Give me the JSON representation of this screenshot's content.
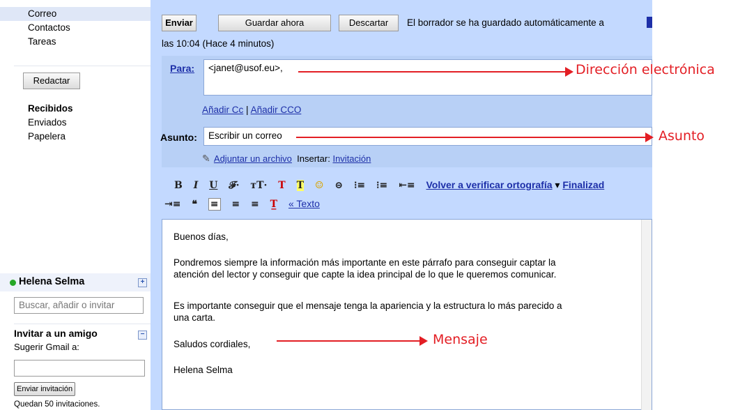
{
  "sidebar": {
    "nav": [
      "Correo",
      "Contactos",
      "Tareas"
    ],
    "compose_label": "Redactar",
    "folders": [
      "Recibidos",
      "Enviados",
      "Papelera"
    ],
    "chat": {
      "user_name": "Helena Selma",
      "expand_label": "+",
      "search_placeholder": "Buscar, añadir o invitar"
    },
    "invite": {
      "title": "Invitar a un amigo",
      "collapse_label": "−",
      "subtitle": "Sugerir Gmail a:",
      "send_label": "Enviar invitación",
      "remaining": "Quedan 50 invitaciones."
    }
  },
  "compose": {
    "send_label": "Enviar",
    "save_label": "Guardar ahora",
    "discard_label": "Descartar",
    "autosave_text": "El borrador se ha guardado automáticamente a",
    "autosave_time": "las 10:04 (Hace 4 minutos)",
    "to_label": "Para:",
    "to_value": "<janet@usof.eu>,",
    "add_cc": "Añadir Cc",
    "cc_sep": "|",
    "add_bcc": "Añadir CCO",
    "subject_label": "Asunto:",
    "subject_value": "Escribir un correo",
    "attach_label": "Adjuntar un archivo",
    "insert_label": "Insertar:",
    "insert_link": "Invitación",
    "toolbar": {
      "bold": "B",
      "italic": "I",
      "underline": "U",
      "font": "𝓕·",
      "size": "тT·",
      "text_color": "T",
      "highlight": "T",
      "emoticon": "☺",
      "link": "⊝",
      "numbered_list": "⁝≡",
      "bulleted_list": "⁝≡",
      "outdent": "⇤≡",
      "spellcheck": "Volver a verificar ortografía",
      "spell_dropdown": "▾",
      "finish": "Finalizad",
      "indent": "⇥≡",
      "quote": "❝",
      "align_left": "≡",
      "align_center": "≡",
      "align_right": "≡",
      "clear_format": "T̲",
      "plain_text": "« Texto"
    },
    "body": [
      "Buenos días,",
      "Pondremos siempre la información más importante en este párrafo para conseguir captar la",
      "atención del lector y conseguir que capte la idea principal de lo que le queremos comunicar.",
      "Es importante conseguir que el mensaje tenga la apariencia y la estructura lo más parecido a",
      "una carta.",
      "Saludos cordiales,",
      "Helena Selma"
    ]
  },
  "annotations": {
    "address": "Dirección electrónica",
    "subject": "Asunto",
    "message": "Mensaje"
  },
  "colors": {
    "accent": "#c3d9ff",
    "annotation": "#e31e24",
    "link": "#1d2fa8",
    "online": "#27a827"
  }
}
